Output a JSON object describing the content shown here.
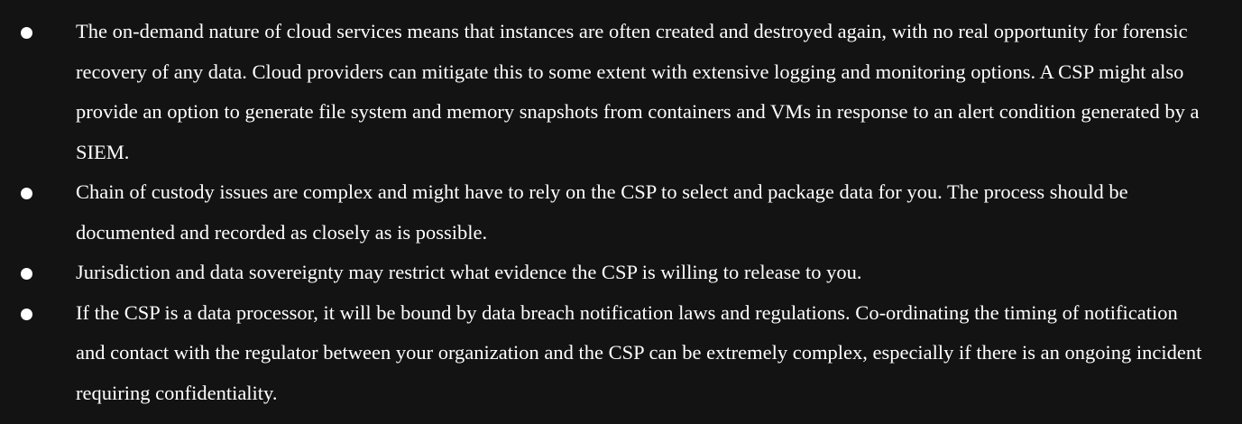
{
  "document": {
    "bullets": [
      "The on-demand nature of cloud services means that instances are often created and destroyed again, with no real opportunity for forensic recovery of any data. Cloud providers can mitigate this to some extent with extensive logging and monitoring options. A CSP might also provide an option to generate file system and memory snapshots from containers and VMs in response to an alert condition generated by a SIEM.",
      "Chain of custody issues are complex and might have to rely on the CSP to select and package data for you. The process should be documented and recorded as closely as is possible.",
      "Jurisdiction and data sovereignty may restrict what evidence the CSP is willing to release to you.",
      "If the CSP is a data processor, it will be bound by data breach notification laws and regulations. Co-ordinating the timing of notification and contact with the regulator between your organization and the CSP can be extremely complex, especially if there is an ongoing incident requiring confidentiality."
    ]
  }
}
